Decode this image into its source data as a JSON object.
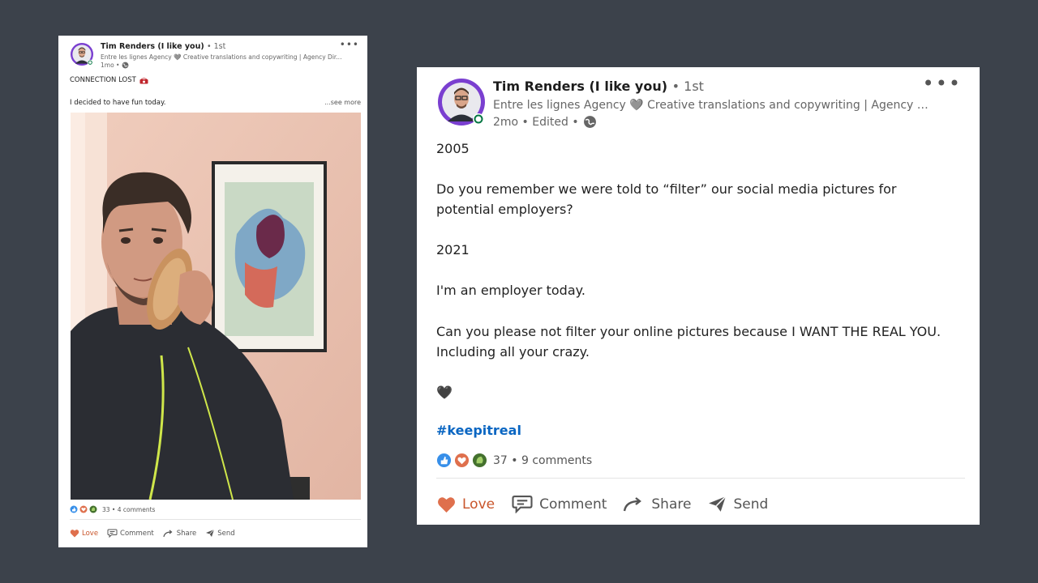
{
  "small_post": {
    "author_name": "Tim Renders (I like you)",
    "connection": "• 1st",
    "headline": "Entre les lignes Agency 🩶 Creative translations and copywriting | Agency Dir...",
    "meta": "1mo •",
    "line1": "CONNECTION LOST",
    "line2": "I decided to have fun today.",
    "see_more": "...see more",
    "reaction_summary": "33 • 4 comments",
    "actions": {
      "love": "Love",
      "comment": "Comment",
      "share": "Share",
      "send": "Send"
    }
  },
  "large_post": {
    "author_name": "Tim Renders (I like you)",
    "connection": "• 1st",
    "headline": "Entre les lignes Agency 🩶 Creative translations and copywriting | Agency Direc...",
    "meta": "2mo • Edited •",
    "paragraphs": {
      "p1": "2005",
      "p2": "Do you remember we were told to “filter” our social media pictures for potential employers?",
      "p3": "2021",
      "p4": "I'm an employer today.",
      "p5": "Can you please not filter your online pictures because I WANT THE REAL YOU. Including all your crazy.",
      "p6": "🖤"
    },
    "hashtag": "#keepitreal",
    "reaction_summary": "37 • 9 comments",
    "actions": {
      "love": "Love",
      "comment": "Comment",
      "share": "Share",
      "send": "Send"
    }
  },
  "colors": {
    "background": "#3c424b",
    "link_blue": "#0a66c2",
    "love_orange": "#c9552b",
    "avatar_ring": "#7a3fd0",
    "online_green": "#057642"
  },
  "icons": [
    "avatar",
    "globe-icon",
    "more-icon",
    "telephone-icon",
    "like-reaction-icon",
    "love-reaction-icon",
    "insightful-reaction-icon",
    "love-icon",
    "comment-icon",
    "share-icon",
    "send-icon",
    "heart-icon"
  ]
}
